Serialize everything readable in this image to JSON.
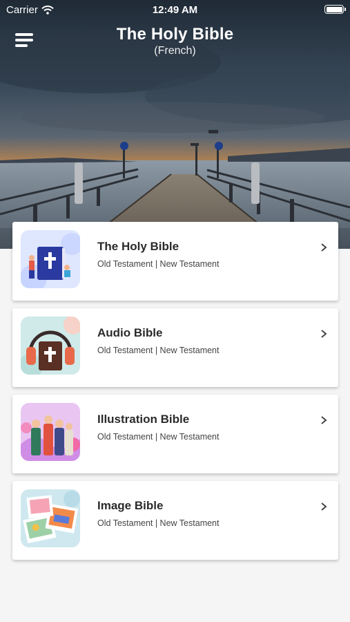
{
  "status_bar": {
    "carrier": "Carrier",
    "time": "12:49 AM"
  },
  "header": {
    "title": "The Holy Bible",
    "subtitle": "(French)"
  },
  "cards": [
    {
      "title": "The Holy Bible",
      "subtitle": "Old Testament | New Testament",
      "icon": "bible-book-icon"
    },
    {
      "title": "Audio Bible",
      "subtitle": "Old Testament | New Testament",
      "icon": "headphones-bible-icon"
    },
    {
      "title": "Illustration Bible",
      "subtitle": "Old Testament | New Testament",
      "icon": "illustration-figures-icon"
    },
    {
      "title": "Image Bible",
      "subtitle": "Old Testament | New Testament",
      "icon": "photo-collage-icon"
    }
  ]
}
